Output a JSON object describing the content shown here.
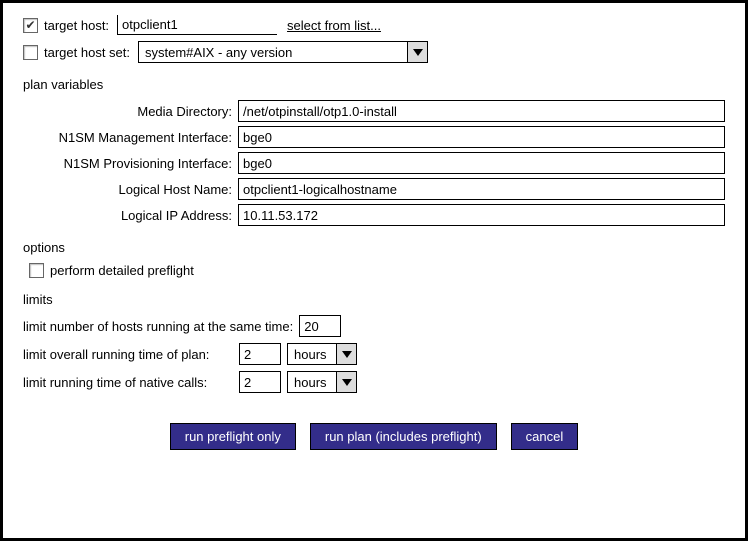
{
  "target": {
    "host_label": "target host:",
    "host_value": "otpclient1",
    "select_from_list": "select from list...",
    "host_checked": true,
    "hostset_label": "target host set:",
    "hostset_value": "system#AIX - any version",
    "hostset_checked": false
  },
  "plan_vars": {
    "header": "plan variables",
    "rows": [
      {
        "label": "Media Directory:",
        "value": "/net/otpinstall/otp1.0-install"
      },
      {
        "label": "N1SM Management Interface:",
        "value": "bge0"
      },
      {
        "label": "N1SM Provisioning Interface:",
        "value": "bge0"
      },
      {
        "label": "Logical Host Name:",
        "value": "otpclient1-logicalhostname"
      },
      {
        "label": "Logical IP Address:",
        "value": "10.11.53.172"
      }
    ]
  },
  "options": {
    "header": "options",
    "detailed_label": "perform detailed preflight",
    "detailed_checked": false
  },
  "limits": {
    "header": "limits",
    "hosts_label": "limit number of hosts running at the same time:",
    "hosts_value": "20",
    "overall_label": "limit overall running time of plan:",
    "overall_value": "2",
    "overall_unit": "hours",
    "native_label": "limit running time of native calls:",
    "native_value": "2",
    "native_unit": "hours"
  },
  "buttons": {
    "preflight": "run preflight only",
    "runplan": "run plan (includes preflight)",
    "cancel": "cancel"
  }
}
